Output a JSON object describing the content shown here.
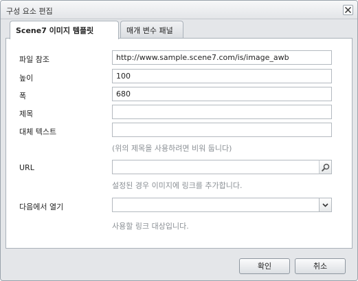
{
  "dialog": {
    "title": "구성 요소 편집",
    "close_icon": "close-icon"
  },
  "tabs": [
    {
      "label": "Scene7 이미지 템플릿",
      "active": true
    },
    {
      "label": "매개 변수 패널",
      "active": false
    }
  ],
  "form": {
    "file_ref": {
      "label": "파일 참조",
      "value": "http://www.sample.scene7.com/is/image_awb"
    },
    "height": {
      "label": "높이",
      "value": "100"
    },
    "width": {
      "label": "폭",
      "value": "680"
    },
    "title": {
      "label": "제목",
      "value": ""
    },
    "alt_text": {
      "label": "대체 텍스트",
      "value": "",
      "hint": "(위의 제목을 사용하려면 비워 둡니다)"
    },
    "url": {
      "label": "URL",
      "value": "",
      "hint": "설정된 경우 이미지에 링크를 추가합니다.",
      "icon": "search-icon"
    },
    "open_in": {
      "label": "다음에서 열기",
      "value": "",
      "hint": "사용할 링크 대상입니다.",
      "icon": "chevron-down-icon"
    }
  },
  "footer": {
    "ok_label": "확인",
    "cancel_label": "취소"
  }
}
